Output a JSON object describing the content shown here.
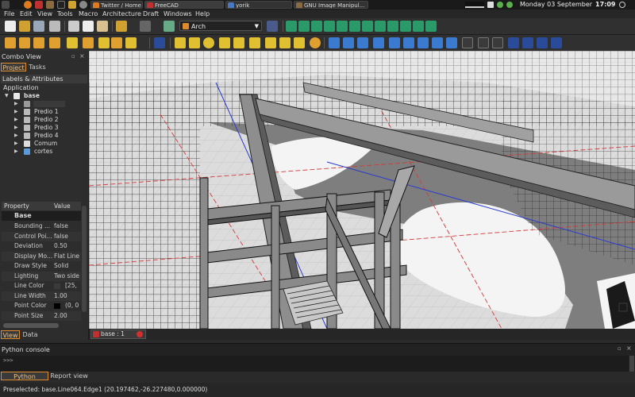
{
  "taskbar": {
    "tasks": [
      {
        "label": "Twitter / Home - Nig...",
        "color": "#e07a1f"
      },
      {
        "label": "FreeCAD",
        "color": "#c03030"
      },
      {
        "label": "yorik",
        "color": "#4a78c0"
      },
      {
        "label": "GNU Image Manipul...",
        "color": "#8a6a40"
      }
    ],
    "date": "Monday 03 September",
    "time": "17:09"
  },
  "menubar": [
    "File",
    "Edit",
    "View",
    "Tools",
    "Macro",
    "Architecture",
    "Draft",
    "Windows",
    "Help"
  ],
  "toolbar": {
    "workbench": "Arch",
    "accent": "#e08a2e"
  },
  "combo_view": {
    "title": "Combo View",
    "tabs": [
      "Project",
      "Tasks"
    ],
    "labels_attributes": "Labels & Attributes",
    "application": "Application",
    "tree": [
      {
        "label": "base",
        "bold": true
      },
      {
        "label": "Predio 1"
      },
      {
        "label": "Predio 2"
      },
      {
        "label": "Predio 3"
      },
      {
        "label": "Predio 4"
      },
      {
        "label": "Comum"
      },
      {
        "label": "cortes"
      }
    ]
  },
  "properties": {
    "header": {
      "property": "Property",
      "value": "Value"
    },
    "group": "Base",
    "rows": [
      {
        "key": "Bounding ...",
        "value": "false"
      },
      {
        "key": "Control Poi...",
        "value": "false"
      },
      {
        "key": "Deviation",
        "value": "0.50"
      },
      {
        "key": "Display Mo...",
        "value": "Flat Line"
      },
      {
        "key": "Draw Style",
        "value": "Solid"
      },
      {
        "key": "Lighting",
        "value": "Two side"
      },
      {
        "key": "Line Color",
        "value": "[25,",
        "swatch": "#3a3a3a"
      },
      {
        "key": "Line Width",
        "value": "1.00"
      },
      {
        "key": "Point Color",
        "value": "(0, 0",
        "swatch": "#000000"
      },
      {
        "key": "Point Size",
        "value": "2.00"
      }
    ],
    "tabs": [
      "View",
      "Data"
    ]
  },
  "document_tab": {
    "label": "base : 1"
  },
  "python_console": {
    "title": "Python console",
    "prompt": ">>>"
  },
  "bottom_tabs": [
    "Python console",
    "Report view"
  ],
  "status": "Preselected: base.Line064.Edge1 (20.197462,-26.227480,0.000000)"
}
